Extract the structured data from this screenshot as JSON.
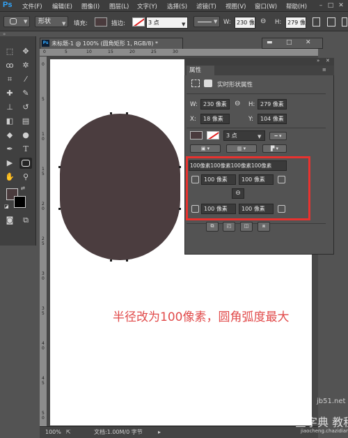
{
  "menubar": {
    "logo": "Ps",
    "items": [
      "文件(F)",
      "编辑(E)",
      "图像(I)",
      "图层(L)",
      "文字(Y)",
      "选择(S)",
      "滤镜(T)",
      "视图(V)",
      "窗口(W)",
      "帮助(H)"
    ]
  },
  "options": {
    "mode": "形状",
    "fill_label": "填充:",
    "stroke_label": "描边:",
    "stroke_size": "3 点",
    "w_label": "W:",
    "w_value": "230 像",
    "h_label": "H:",
    "h_value": "279 像"
  },
  "document": {
    "tab_title": "未标题-1 @ 100% (圆角矩形 1, RGB/8) *",
    "zoom": "100%",
    "doc_info": "文档:1.00M/0 字节",
    "ruler_top": [
      "0",
      "5",
      "1",
      "0",
      "1",
      "5",
      "2",
      "0",
      "2",
      "5",
      "3",
      "0"
    ],
    "ruler_left": [
      "0",
      "5",
      "1",
      "0",
      "1",
      "5",
      "2",
      "0",
      "2",
      "5",
      "3",
      "0",
      "3",
      "5",
      "4",
      "0",
      "4",
      "5",
      "5",
      "0"
    ]
  },
  "properties": {
    "title": "属性",
    "section": "实时形状属性",
    "w_label": "W:",
    "w_value": "230 像素",
    "h_label": "H:",
    "h_value": "279 像素",
    "x_label": "X:",
    "x_value": "18 像素",
    "y_label": "Y:",
    "y_value": "104 像素",
    "stroke_size": "3 点",
    "radius_combined": "100像素100像素100像素100像素",
    "radius_tl": "100 像素",
    "radius_tr": "100 像素",
    "radius_bl": "100 像素",
    "radius_br": "100 像素"
  },
  "annotation": "半径改为100像素，圆角弧度最大",
  "watermark": {
    "site": "jb51.net",
    "main": "查字典 教程网",
    "url": "jiaocheng.chazidian.com"
  },
  "colors": {
    "shape_fill": "#4b3d3f",
    "highlight": "#e8322f",
    "annotation": "#e14a4a"
  }
}
